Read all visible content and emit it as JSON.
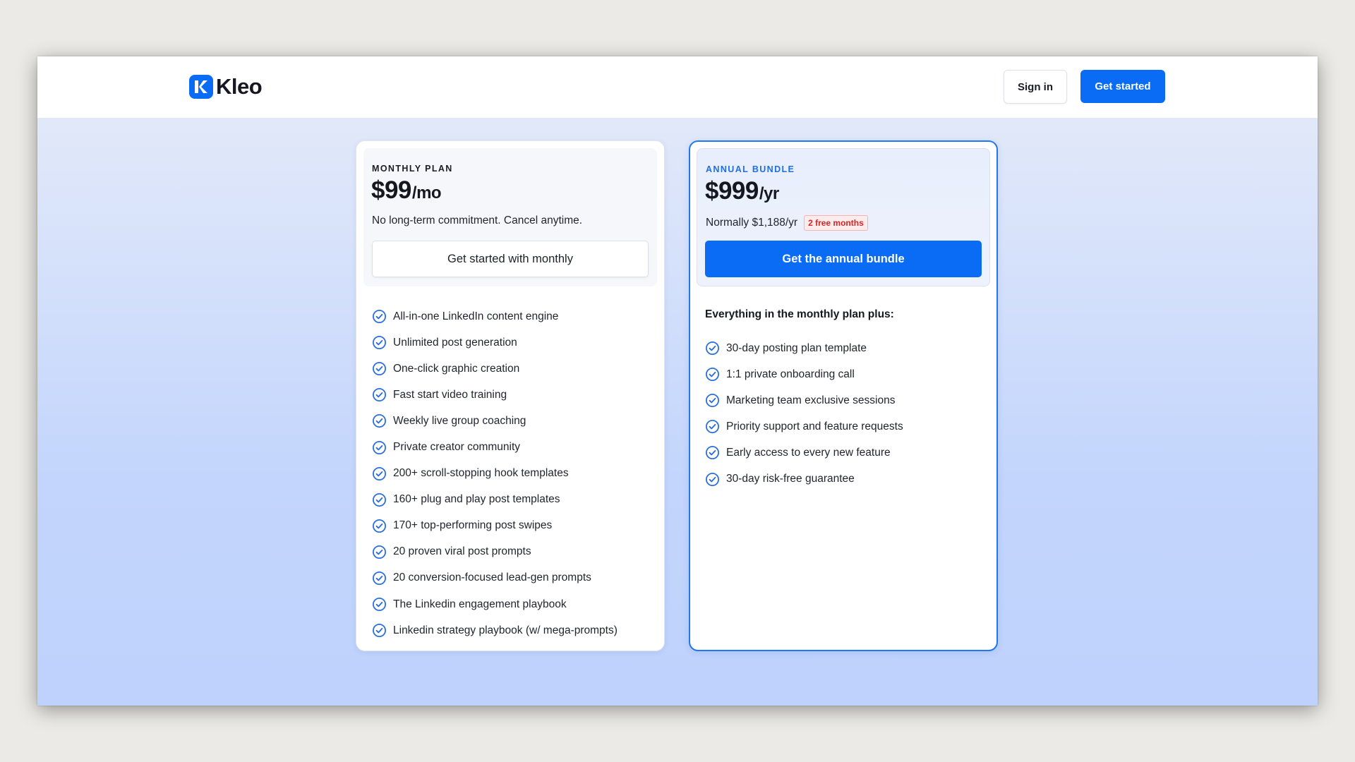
{
  "header": {
    "brand": "Kleo",
    "logo_icon": "kleo-logo-icon",
    "sign_in_label": "Sign in",
    "get_started_label": "Get started"
  },
  "colors": {
    "accent": "#0a6cf5",
    "badge_red": "#d32626",
    "check_blue": "#2a6fe0"
  },
  "monthly": {
    "label": "MONTHLY PLAN",
    "price": "$99",
    "unit": "/mo",
    "subtitle": "No long-term commitment. Cancel anytime.",
    "cta": "Get started with monthly",
    "features": [
      "All-in-one LinkedIn content engine",
      "Unlimited post generation",
      "One-click graphic creation",
      "Fast start video training",
      "Weekly live group coaching",
      "Private creator community",
      "200+ scroll-stopping hook templates",
      "160+ plug and play post templates",
      "170+ top-performing post swipes",
      "20 proven viral post prompts",
      "20 conversion-focused lead-gen prompts",
      "The Linkedin engagement playbook",
      "Linkedin strategy playbook (w/ mega-prompts)"
    ]
  },
  "annual": {
    "label": "ANNUAL BUNDLE",
    "price": "$999",
    "unit": "/yr",
    "normal_price": "Normally $1,188/yr",
    "badge": "2 free months",
    "cta": "Get the annual bundle",
    "plus_heading": "Everything in the monthly plan plus:",
    "features": [
      "30-day posting plan template",
      "1:1 private onboarding call",
      "Marketing team exclusive sessions",
      "Priority support and feature requests",
      "Early access to every new feature",
      "30-day risk-free guarantee"
    ]
  }
}
